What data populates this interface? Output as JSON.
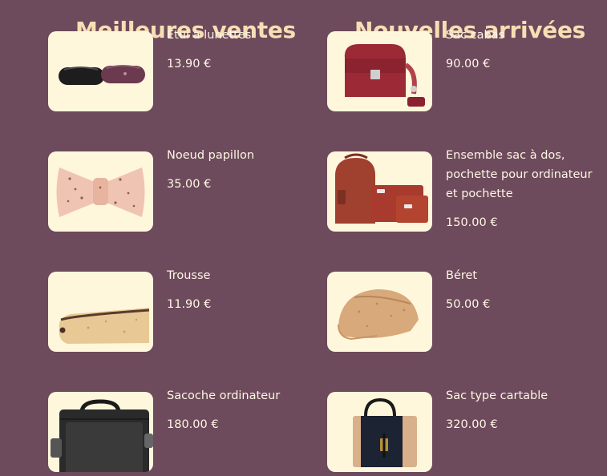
{
  "columns": {
    "left": {
      "title": "Meilleures ventes",
      "products": [
        {
          "name": "Étui à lunettes",
          "price": "13.90 €",
          "image": "glasses-case-image"
        },
        {
          "name": "Noeud papillon",
          "price": "35.00 €",
          "image": "bow-tie-image"
        },
        {
          "name": "Trousse",
          "price": "11.90 €",
          "image": "pencil-case-image"
        },
        {
          "name": "Sacoche ordinateur",
          "price": "180.00 €",
          "image": "laptop-bag-image"
        }
      ]
    },
    "right": {
      "title": "Nouvelles arrivées",
      "products": [
        {
          "name": "Sac cabas",
          "price": "90.00 €",
          "image": "red-handbag-image"
        },
        {
          "name": "Ensemble sac à dos, pochette pour ordinateur et pochette",
          "price": "150.00 €",
          "image": "backpack-set-image"
        },
        {
          "name": "Béret",
          "price": "50.00 €",
          "image": "beret-image"
        },
        {
          "name": "Sac type cartable",
          "price": "320.00 €",
          "image": "satchel-image"
        }
      ]
    }
  },
  "colors": {
    "background": "#6d4a5c",
    "heading": "#f6dfb4",
    "text": "#fff6e5",
    "card": "#fff7dc"
  }
}
